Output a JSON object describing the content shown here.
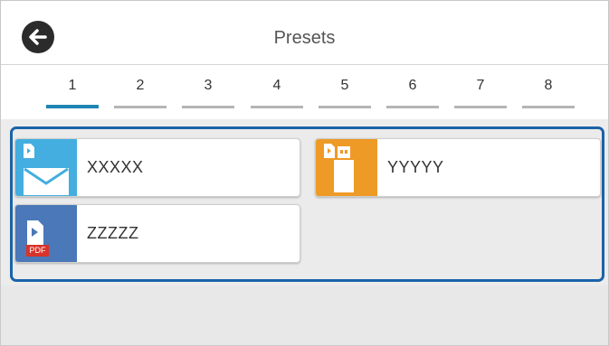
{
  "header": {
    "title": "Presets",
    "back_icon": "arrow-left-icon"
  },
  "tabs": [
    {
      "label": "1",
      "active": true
    },
    {
      "label": "2",
      "active": false
    },
    {
      "label": "3",
      "active": false
    },
    {
      "label": "4",
      "active": false
    },
    {
      "label": "5",
      "active": false
    },
    {
      "label": "6",
      "active": false
    },
    {
      "label": "7",
      "active": false
    },
    {
      "label": "8",
      "active": false
    }
  ],
  "presets": [
    {
      "label": "XXXXX",
      "icon": "email-icon",
      "color": "#43aedf"
    },
    {
      "label": "YYYYY",
      "icon": "usb-memory-icon",
      "color": "#ee9a26"
    },
    {
      "label": "ZZZZZ",
      "icon": "pdf-icon",
      "color": "#4a78b8",
      "badge": "PDF"
    }
  ],
  "colors": {
    "accent": "#1e84b4",
    "selection_border": "#1b63a8"
  }
}
